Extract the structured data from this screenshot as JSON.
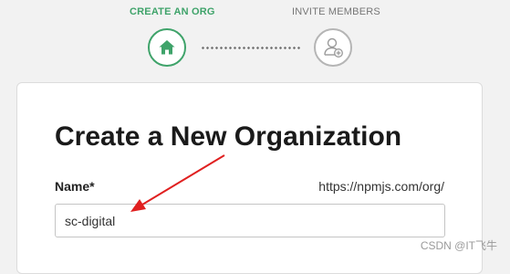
{
  "stepper": {
    "steps": [
      {
        "label": "CREATE AN ORG",
        "icon": "home-icon",
        "state": "active"
      },
      {
        "label": "INVITE MEMBERS",
        "icon": "add-user-icon",
        "state": "inactive"
      }
    ],
    "colors": {
      "active": "#3fa36a",
      "inactive": "#b5b5b5"
    }
  },
  "form": {
    "title": "Create a New Organization",
    "name_label": "Name*",
    "url_prefix": "https://npmjs.com/org/",
    "name_value": "sc-digital"
  },
  "annotation": {
    "color": "#e02020"
  },
  "watermark": "CSDN @IT飞牛"
}
